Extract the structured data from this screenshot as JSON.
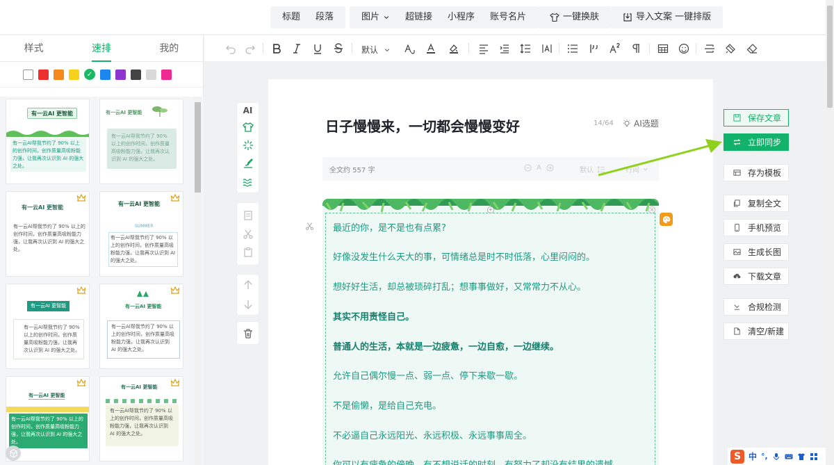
{
  "topmenu": {
    "group1": [
      "标题",
      "段落"
    ],
    "group2": [
      "图片",
      "超链接",
      "小程序",
      "账号名片"
    ],
    "skin": "一键换肤",
    "import": "导入文案 一键排版"
  },
  "leftpanel": {
    "tabs": [
      "样式",
      "速排",
      "我的"
    ],
    "colors": [
      "#ffffff",
      "#ee2f2f",
      "#f5891b",
      "#f6d21c",
      "#17b964",
      "#1a87f0",
      "#8c35cf",
      "#444444",
      "#d9d9d9",
      "#ee2b8e"
    ],
    "templates": [
      {
        "title": "有一云AI 更智能",
        "text": "有一云AI帮我节约了 90% 以上的创作时间，创作质量高吸粉能力强，让我再次认识到 AI 的强大之处。"
      },
      {
        "title": "有一云AI 更智能",
        "text": "有一云AI帮我节约了 90% 以上的创作时间，创作质量高吸粉能力强，让我再次认识到 AI 的强大之处。"
      },
      {
        "title": "有一云AI 更智能",
        "text": "有一云AI帮我节约了 90% 以上的创作时间，创作质量高吸粉能力强，让我再次认识到 AI 的强大之处。"
      },
      {
        "title": "有一云AI 更智能",
        "subtitle": "SUMMER",
        "text": "有一云AI帮我节约了 90% 以上的创作时间，创作质量高吸粉能力强，让我再次认识到 AI 的强大之处。"
      },
      {
        "title": "有一云AI 更智能",
        "text": "有一云AI帮我节约了 90% 以上的创作时间，创作质量高吸粉能力强，让我再次认识到 AI 的强大之处。"
      },
      {
        "title": "有一云AI 更智能",
        "text": "有一云AI帮我节约了 90% 以上的创作时间，创作质量高吸粉能力强，让我再次认识到 AI 的强大之处。"
      },
      {
        "title": "有一云AI 更智能",
        "text": "有一云AI帮我节约了 90% 以上的创作时间，创作质量高吸粉能力强，让我再次认识到 AI 的强大之处。"
      },
      {
        "title": "有一云AI 更智能",
        "text": "有一云AI帮我节约了 90% 以上的创作时间，创作质量高吸粉能力强，让我再次认识到 AI 的强大之处。"
      }
    ]
  },
  "toolbar": {
    "font_default": "默认",
    "icons": [
      "undo-icon",
      "redo-icon",
      "bold-icon",
      "italic-icon",
      "underline-icon",
      "strikethrough-icon",
      "font-size-icon",
      "font-color-icon",
      "highlight-icon",
      "align-icon",
      "indent-icon",
      "line-height-icon",
      "letter-spacing-icon",
      "list-icon",
      "quote-icon",
      "superscript-icon",
      "paragraph-icon",
      "table-icon",
      "emoji-icon",
      "divider-icon",
      "format-brush-icon",
      "eraser-icon"
    ]
  },
  "sidetools": {
    "ai_label": "AI"
  },
  "editor": {
    "title": "日子慢慢来，一切都会慢慢变好",
    "counter": "14/64",
    "ai_title": "AI选题",
    "word_count": "全文约 557 字",
    "font_letter": "A",
    "default_label": "默认",
    "trailing_label": "行间",
    "paragraphs": [
      {
        "text": "最近的你，是不是也有点累?",
        "bold": false
      },
      {
        "text": "好像没发生什么天大的事，可情绪总是时不时低落，心里闷闷的。",
        "bold": false
      },
      {
        "text": "想好好生活，却总被琐碎打乱；想事事做好，又常常力不从心。",
        "bold": false
      },
      {
        "text": "其实不用责怪自己。",
        "bold": true
      },
      {
        "text": "普通人的生活，本就是一边疲惫，一边自愈，一边继续。",
        "bold": true
      },
      {
        "text": "允许自己偶尔慢一点、弱一点、停下来歇一歇。",
        "bold": false
      },
      {
        "text": "不是偷懒，是给自己充电。",
        "bold": false
      },
      {
        "text": "不必逼自己永远阳光、永远积极、永远事事周全。",
        "bold": false
      },
      {
        "text": "你可以有疲惫的傍晚，有不想说话的时刻，有努力了却没有结果的遗憾",
        "bold": false
      }
    ]
  },
  "rightcol": {
    "save": "保存文章",
    "sync": "立即同步",
    "template": "存为模板",
    "copy": "复制全文",
    "mobile": "手机预览",
    "longimg": "生成长图",
    "download": "下载文章",
    "check": "合规检测",
    "clear": "清空/新建"
  },
  "ime": {
    "lang": "中",
    "punct": "°,"
  },
  "colors": {
    "accent": "#12b26a",
    "sync_btn": "#12b26a",
    "arrow": "#8fd11c",
    "article_text": "#1e9a82"
  }
}
